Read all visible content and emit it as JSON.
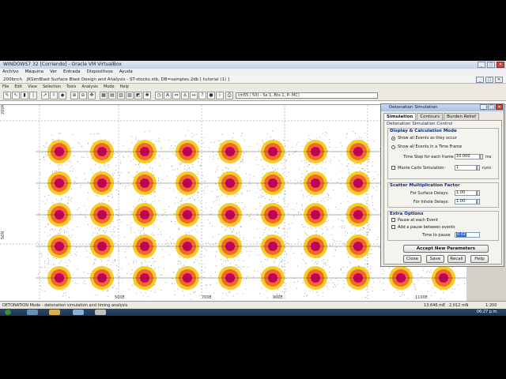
{
  "vm": {
    "title": "WINDOWS7 32 [Corriendo] - Oracle VM VirtualBox",
    "menu": [
      "Archivo",
      "Máquina",
      "Ver",
      "Entrada",
      "Dispositivos",
      "Ayuda"
    ]
  },
  "app": {
    "title": "JKSimBlast Surface Blast Design and Analysis - ST-stocks.stb, DB=samples.2db [ tutorial (1) ]",
    "menu": [
      "File",
      "Edit",
      "View",
      "Selection",
      "Tools",
      "Analysis",
      "Mode",
      "Help"
    ],
    "coord_readout": "(m55 / 50) - Sx 1, Btx 1, P- MC)",
    "left_label": "200bnch"
  },
  "plot": {
    "x_labels": [
      "500E",
      "700E",
      "900E",
      "1100E"
    ],
    "y_labels": [
      "200N",
      "50N"
    ],
    "rows": 5,
    "cols": 10,
    "colors": {
      "core": "#c4005a",
      "mid": "#f0602a",
      "outer": "#f5c400",
      "scatter": "#8a8a8a"
    }
  },
  "status": {
    "mode": "DETONATION Mode - detonation simulation and timing analysis",
    "pos": "13.646 mE",
    "pos2": "2.012 mN",
    "zoom": "1:200"
  },
  "dialog": {
    "title": "Detonation Simulation",
    "tabs": [
      "Simulation",
      "Contours",
      "Burden Relief"
    ],
    "section": "Detonation Simulation Control",
    "display_group": "Display & Calculation  Mode",
    "radio_show_all": "Show all Events as they occur",
    "radio_time_frame": "Show all Events in a Time Frame",
    "time_step_label": "Time Step for each frame",
    "time_step_value": "10.000",
    "time_step_unit": "ms",
    "monte_carlo_label": "Monte Carlo Simulation:",
    "monte_carlo_value": "1",
    "monte_carlo_unit": "runs",
    "scatter_group": "Scatter Multiplication Factor",
    "surface_label": "For Surface Delays:",
    "surface_value": "1.00",
    "inhole_label": "For Inhole Delays:",
    "inhole_value": "1.00",
    "extra_group": "Extra Options",
    "pause_each_label": "Pause at each Event",
    "pause_between_label": "Add a pause between events",
    "time_pause_label": "Time to pause",
    "time_pause_value": "0.02",
    "accept_button": "Accept New Parameters",
    "close_button": "Close",
    "save_button": "Save",
    "recall_button": "Recall",
    "help_button": "Help"
  },
  "taskbar": {
    "time": "06:27 p.m."
  }
}
